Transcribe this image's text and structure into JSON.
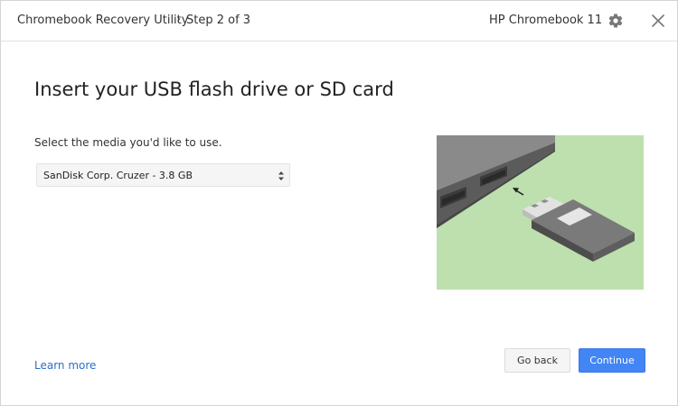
{
  "titlebar": {
    "app_title": "Chromebook Recovery Utility",
    "step_chevron": "›",
    "step_label": "Step 2 of 3",
    "model_name": "HP Chromebook 11",
    "settings_icon": "gear-icon",
    "close_icon": "close-icon"
  },
  "main": {
    "heading": "Insert your USB flash drive or SD card",
    "media_prompt": "Select the media you'd like to use.",
    "media_select": {
      "selected": "SanDisk Corp. Cruzer - 3.8 GB"
    },
    "illustration": {
      "description_icon": "usb-insert-illustration",
      "background_color": "#bde0ae"
    }
  },
  "footer": {
    "learn_more": "Learn more",
    "back_label": "Go back",
    "continue_label": "Continue"
  },
  "colors": {
    "accent": "#4285f4",
    "link": "#2a6ecd"
  }
}
